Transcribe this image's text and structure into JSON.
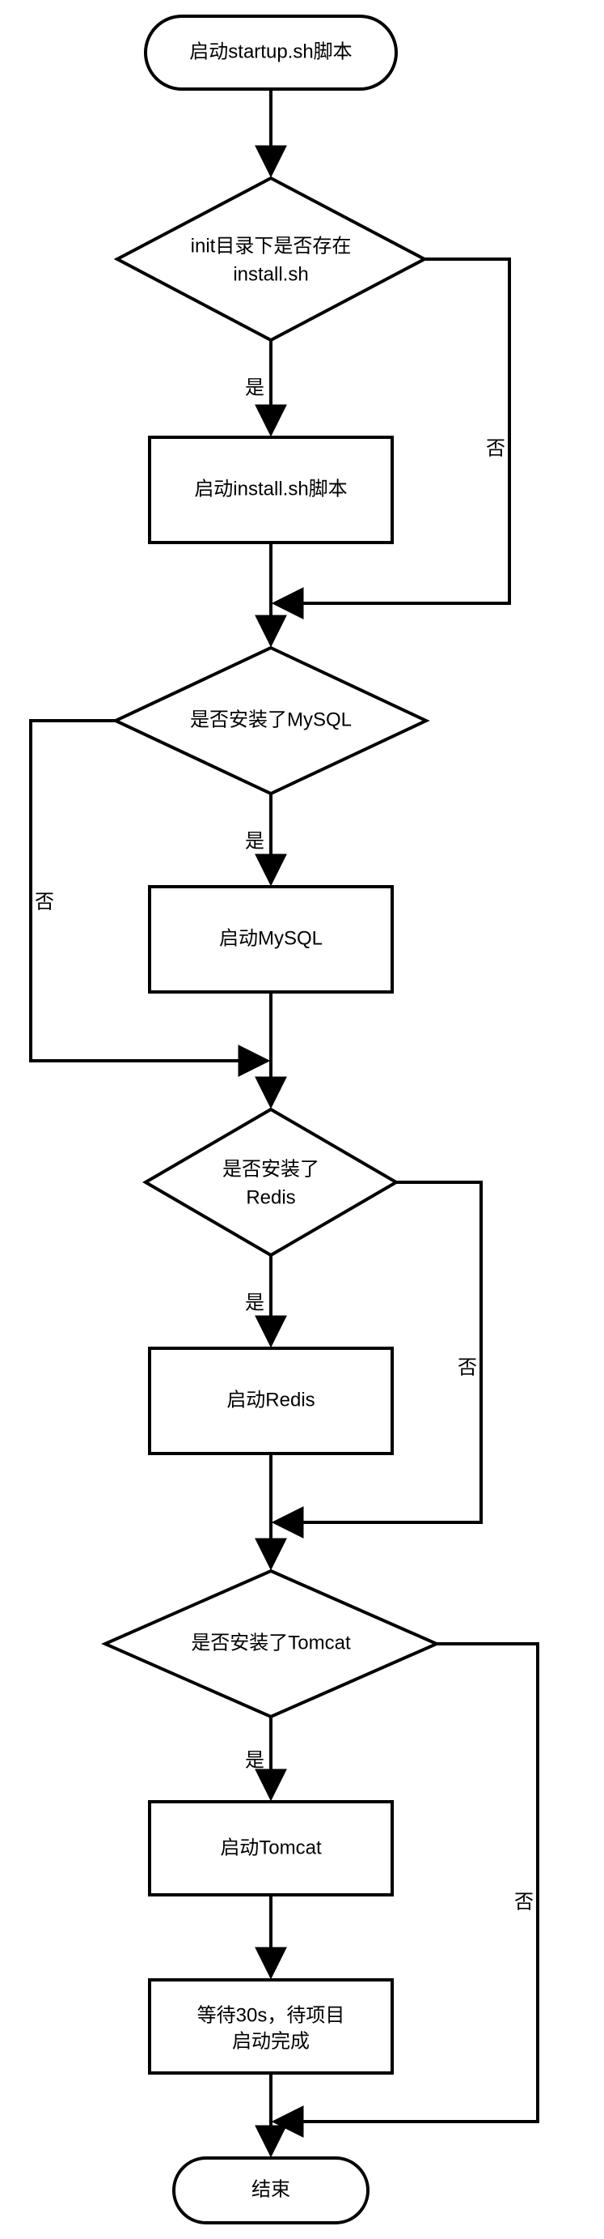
{
  "nodes": {
    "start": {
      "text": "启动startup.sh脚本"
    },
    "dec_install": {
      "line1": "init目录下是否存在",
      "line2": "install.sh"
    },
    "proc_install": {
      "text": "启动install.sh脚本"
    },
    "dec_mysql": {
      "text": "是否安装了MySQL"
    },
    "proc_mysql": {
      "text": "启动MySQL"
    },
    "dec_redis": {
      "line1": "是否安装了",
      "line2": "Redis"
    },
    "proc_redis": {
      "text": "启动Redis"
    },
    "dec_tomcat": {
      "text": "是否安装了Tomcat"
    },
    "proc_tomcat": {
      "text": "启动Tomcat"
    },
    "proc_wait": {
      "line1": "等待30s，待项目",
      "line2": "启动完成"
    },
    "end": {
      "text": "结束"
    }
  },
  "labels": {
    "yes": "是",
    "no": "否"
  },
  "chart_data": {
    "type": "flowchart",
    "title": "",
    "nodes": [
      {
        "id": "start",
        "type": "terminator",
        "text": "启动startup.sh脚本"
      },
      {
        "id": "dec_install",
        "type": "decision",
        "text": "init目录下是否存在 install.sh"
      },
      {
        "id": "proc_install",
        "type": "process",
        "text": "启动install.sh脚本"
      },
      {
        "id": "dec_mysql",
        "type": "decision",
        "text": "是否安装了MySQL"
      },
      {
        "id": "proc_mysql",
        "type": "process",
        "text": "启动MySQL"
      },
      {
        "id": "dec_redis",
        "type": "decision",
        "text": "是否安装了 Redis"
      },
      {
        "id": "proc_redis",
        "type": "process",
        "text": "启动Redis"
      },
      {
        "id": "dec_tomcat",
        "type": "decision",
        "text": "是否安装了Tomcat"
      },
      {
        "id": "proc_tomcat",
        "type": "process",
        "text": "启动Tomcat"
      },
      {
        "id": "proc_wait",
        "type": "process",
        "text": "等待30s，待项目启动完成"
      },
      {
        "id": "end",
        "type": "terminator",
        "text": "结束"
      }
    ],
    "edges": [
      {
        "from": "start",
        "to": "dec_install",
        "label": ""
      },
      {
        "from": "dec_install",
        "to": "proc_install",
        "label": "是"
      },
      {
        "from": "dec_install",
        "to": "dec_mysql",
        "label": "否"
      },
      {
        "from": "proc_install",
        "to": "dec_mysql",
        "label": ""
      },
      {
        "from": "dec_mysql",
        "to": "proc_mysql",
        "label": "是"
      },
      {
        "from": "dec_mysql",
        "to": "dec_redis",
        "label": "否"
      },
      {
        "from": "proc_mysql",
        "to": "dec_redis",
        "label": ""
      },
      {
        "from": "dec_redis",
        "to": "proc_redis",
        "label": "是"
      },
      {
        "from": "dec_redis",
        "to": "dec_tomcat",
        "label": "否"
      },
      {
        "from": "proc_redis",
        "to": "dec_tomcat",
        "label": ""
      },
      {
        "from": "dec_tomcat",
        "to": "proc_tomcat",
        "label": "是"
      },
      {
        "from": "dec_tomcat",
        "to": "end",
        "label": "否"
      },
      {
        "from": "proc_tomcat",
        "to": "proc_wait",
        "label": ""
      },
      {
        "from": "proc_wait",
        "to": "end",
        "label": ""
      }
    ]
  }
}
